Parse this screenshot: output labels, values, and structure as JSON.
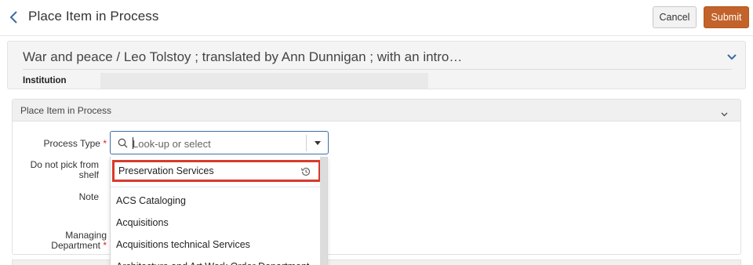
{
  "header": {
    "title": "Place Item in Process",
    "back_icon": "chevron-left-icon",
    "cancel_label": "Cancel",
    "submit_label": "Submit"
  },
  "record": {
    "title": "War and peace / Leo Tolstoy ; translated by Ann Dunnigan ; with an intro…",
    "institution_label": "Institution",
    "institution_value": ""
  },
  "form": {
    "section_title": "Place Item in Process",
    "process_type_label": "Process Type",
    "required_mark": "*",
    "process_type_placeholder": "Look-up or select",
    "do_not_pick_line1": "Do not pick from",
    "do_not_pick_line2": "shelf",
    "note_label": "Note",
    "managing_line1": "Managing",
    "managing_line2": "Department"
  },
  "dropdown": {
    "recent_item": "Preservation Services",
    "items": [
      "ACS Cataloging",
      "Acquisitions",
      "Acquisitions technical Services",
      "Architecture and Art Work Order Department"
    ]
  },
  "colors": {
    "accent": "#3f6ea5",
    "submit": "#c3622a",
    "highlight": "#d83a2b",
    "required": "#dd2222"
  }
}
